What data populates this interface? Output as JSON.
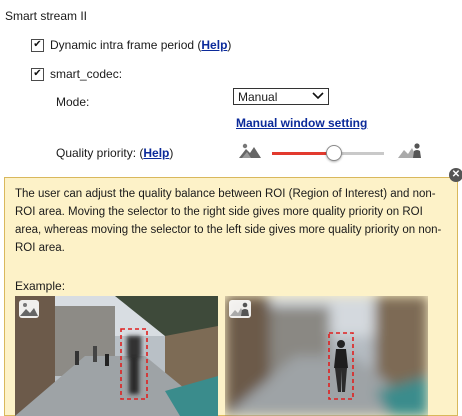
{
  "section_title": "Smart stream II",
  "dynamic_intra": {
    "checked": true,
    "label": "Dynamic intra frame period (",
    "help": "Help",
    "close": ")"
  },
  "smart_codec": {
    "checked": true,
    "label": "smart_codec:"
  },
  "mode": {
    "label": "Mode:",
    "value": "Manual"
  },
  "manual_window_link": "Manual window setting",
  "quality_priority": {
    "label": "Quality priority: (",
    "help": "Help",
    "close": ")",
    "slider_level": 0.54
  },
  "info": {
    "text": "The user can adjust the quality balance between ROI (Region of Interest) and non-ROI area. Moving the selector to the right side gives more quality priority on ROI area, whereas moving the selector to the left side gives more quality priority on non-ROI area.",
    "example_label": "Example:"
  },
  "icons": {
    "left_quality": "landscape-small-icon",
    "right_quality": "portrait-landscape-icon",
    "close": "close-icon"
  },
  "colors": {
    "link": "#0b2a9a",
    "info_bg": "#fdf2c8",
    "roi_box": "#e02020",
    "slider_active": "#e23a2e"
  }
}
